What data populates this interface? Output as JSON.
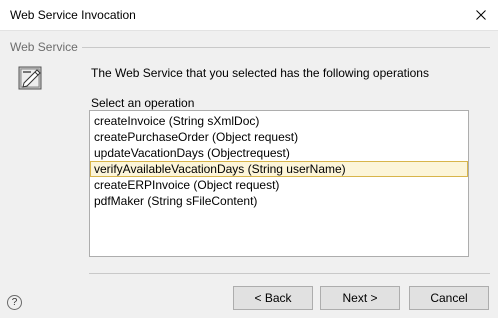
{
  "window": {
    "title": "Web Service Invocation",
    "close_glyph": "✕"
  },
  "section": {
    "header": "Web Service",
    "icon": "web-service-wizard-icon"
  },
  "content": {
    "description": "The Web Service that you selected has the following operations",
    "select_label": "Select an operation",
    "operations": [
      "createInvoice (String sXmlDoc)",
      "createPurchaseOrder (Object request)",
      "updateVacationDays (Objectrequest)",
      "verifyAvailableVacationDays (String userName)",
      "createERPInvoice (Object request)",
      "pdfMaker (String sFileContent)"
    ],
    "selected_index": 3
  },
  "footer": {
    "help_glyph": "?",
    "back_label": "< Back",
    "next_label": "Next >",
    "cancel_label": "Cancel"
  },
  "colors": {
    "selection_bg": "#fcf5d9",
    "selection_border": "#d8b54b",
    "dialog_bg": "#f0f0f0"
  }
}
